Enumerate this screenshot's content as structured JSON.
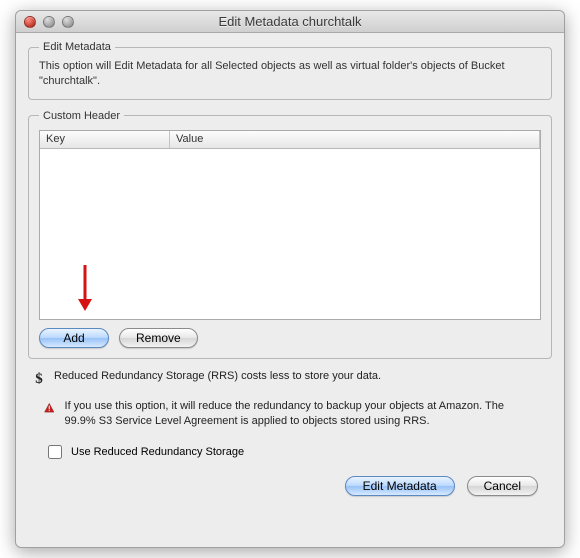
{
  "window": {
    "title": "Edit Metadata  churchtalk"
  },
  "groupbox": {
    "legend": "Edit Metadata",
    "description": "This option will Edit Metadata for all Selected objects as well as virtual folder's objects of Bucket \"churchtalk\"."
  },
  "customHeader": {
    "legend": "Custom Header",
    "columns": {
      "key": "Key",
      "value": "Value"
    },
    "rows": [],
    "buttons": {
      "add": "Add",
      "remove": "Remove"
    }
  },
  "rrs": {
    "infoText": "Reduced Redundancy Storage (RRS) costs less to store your data.",
    "warnText": "If you use this option, it will reduce the redundancy to backup your objects at Amazon. The 99.9% S3 Service Level Agreement is applied to objects stored using RRS.",
    "checkboxLabel": "Use Reduced Redundancy Storage",
    "checked": false
  },
  "footer": {
    "primary": "Edit Metadata",
    "cancel": "Cancel"
  }
}
